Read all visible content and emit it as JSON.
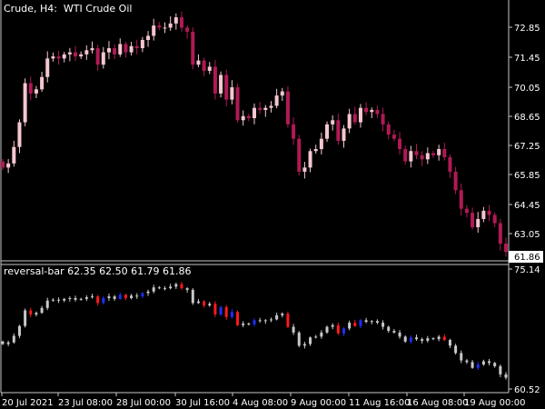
{
  "main_panel": {
    "symbol": "Crude",
    "timeframe": "H4",
    "description": "WTI Crude Oil",
    "current_price": "61.86",
    "price_ticks": [
      "72.85",
      "71.45",
      "70.05",
      "68.65",
      "67.25",
      "65.85",
      "64.45",
      "63.05"
    ]
  },
  "sub_panel": {
    "indicator": "reversal-bar",
    "values": "62.35 62.50 61.79 61.86",
    "price_ticks": [
      "75.14",
      "60.52"
    ]
  },
  "time_axis": [
    "20 Jul 2021",
    "23 Jul 08:00",
    "28 Jul 00:00",
    "30 Jul 16:00",
    "4 Aug 08:00",
    "9 Aug 00:00",
    "11 Aug 16:00",
    "16 Aug 08:00",
    "19 Aug 00:00"
  ],
  "colors": {
    "background": "#000000",
    "grid_separator": "#c8c8c8",
    "bull_candle": "#f4c7d0",
    "bear_candle": "#b01a55",
    "bar_neutral": "#c8c8c8",
    "bar_bull_reversal": "#1e2fff",
    "bar_bear_reversal": "#ff1a1a",
    "text": "#ffffff"
  },
  "chart_data": [
    {
      "type": "candlestick",
      "title": "Crude, H4: WTI Crude Oil",
      "ylim": [
        61.6,
        73.7
      ],
      "close_series": [
        66.0,
        66.2,
        67.0,
        68.2,
        70.1,
        69.6,
        69.8,
        70.4,
        71.3,
        71.4,
        71.3,
        71.5,
        71.6,
        71.4,
        71.5,
        71.7,
        71.8,
        71.0,
        71.6,
        71.8,
        71.5,
        72.0,
        71.6,
        71.9,
        71.8,
        72.2,
        72.4,
        72.9,
        72.8,
        72.8,
        73.0,
        73.3,
        72.8,
        72.6,
        71.0,
        71.2,
        70.7,
        70.9,
        69.6,
        70.5,
        69.3,
        69.9,
        68.3,
        68.5,
        68.4,
        68.9,
        68.8,
        68.9,
        69.0,
        69.5,
        69.7,
        68.1,
        67.4,
        65.8,
        66.0,
        66.8,
        66.9,
        67.4,
        68.1,
        68.3,
        67.3,
        67.9,
        68.6,
        68.2,
        68.9,
        68.7,
        68.8,
        68.6,
        68.1,
        67.6,
        67.4,
        66.9,
        66.3,
        66.8,
        66.6,
        66.4,
        66.7,
        66.6,
        66.9,
        66.5,
        65.8,
        64.9,
        64.0,
        63.8,
        63.1,
        63.5,
        63.9,
        63.7,
        63.3,
        62.3,
        61.9
      ]
    },
    {
      "type": "bar",
      "title": "reversal-bar 62.35 62.50 61.79 61.86",
      "ylim": [
        60.52,
        75.14
      ]
    }
  ]
}
